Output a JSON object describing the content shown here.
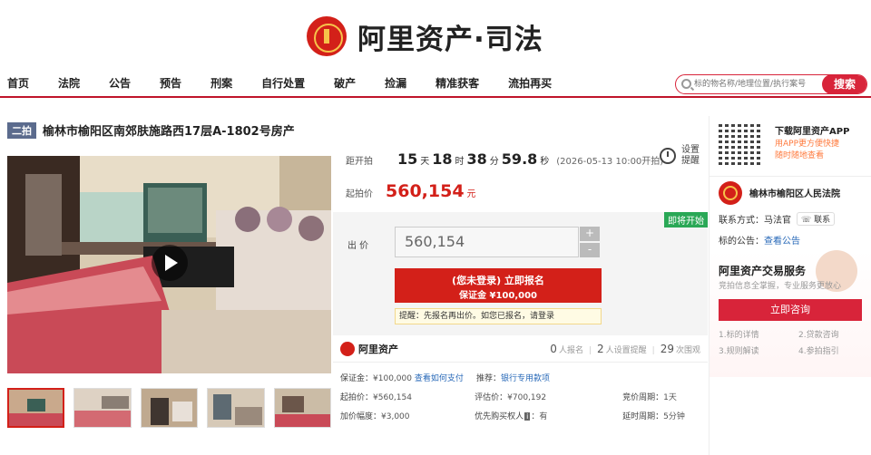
{
  "header": {
    "logo_text": "阿里资产·司法"
  },
  "nav": {
    "items": [
      "首页",
      "法院",
      "公告",
      "预告",
      "刑案",
      "自行处置",
      "破产",
      "捡漏",
      "精准获客",
      "流拍再买"
    ]
  },
  "search": {
    "placeholder": "标的物名称/地理位置/执行案号",
    "button": "搜索"
  },
  "item": {
    "round_tag": "二拍",
    "title": "榆林市榆阳区南郊肤施路西17层A-1802号房产"
  },
  "countdown": {
    "label": "距开拍",
    "days": "15",
    "days_unit": "天",
    "hours": "18",
    "hours_unit": "时",
    "minutes": "38",
    "minutes_unit": "分",
    "seconds": "59.8",
    "seconds_unit": "秒",
    "start_time": "(2026-05-13 10:00开拍)"
  },
  "remind": {
    "line1": "设置",
    "line2": "提醒"
  },
  "start_price": {
    "label": "起拍价",
    "value": "560,154",
    "unit": "元"
  },
  "bid": {
    "tag": "即将开始",
    "label": "出 价",
    "value": "560,154",
    "plus": "+",
    "minus": "-",
    "signup_line1": "(您未登录) 立即报名",
    "signup_line2": "保证金 ¥100,000",
    "tip": "提醒：先报名再出价。如您已报名，请登录"
  },
  "brand": {
    "name": "阿里资产"
  },
  "stats": [
    {
      "num": "0",
      "label": "人报名"
    },
    {
      "num": "2",
      "label": "人设置提醒"
    },
    {
      "num": "29",
      "label": "次围观"
    }
  ],
  "details": {
    "deposit_label": "保证金：",
    "deposit": "¥100,000",
    "pay_link": "查看如何支付",
    "recommend_label": "推荐：",
    "recommend_link": "银行专用款项",
    "start_label": "起拍价：",
    "start": "¥560,154",
    "assess_label": "评估价：",
    "assess": "¥700,192",
    "period_label": "竞价周期：",
    "period": "1天",
    "step_label": "加价幅度：",
    "step": "¥3,000",
    "priority_label": "优先购买权人",
    "priority_badge": "i",
    "priority": "：有",
    "delay_label": "延时周期：",
    "delay": "5分钟"
  },
  "sidebar": {
    "app_title": "下载阿里资产APP",
    "app_sub1": "用APP更方便快捷",
    "app_sub2": "随时随地查看",
    "court": "榆林市榆阳区人民法院",
    "contact_label": "联系方式：",
    "contact_name": "马法官",
    "contact_btn": "联系",
    "notice_label": "标的公告：",
    "notice_link": "查看公告",
    "svc_title": "阿里资产交易服务",
    "svc_sub": "竞拍信息全掌握，专业服务更放心",
    "consult": "立即咨询",
    "faq": [
      "1.标的详情",
      "2.贷款咨询",
      "3.规则解读",
      "4.参拍指引"
    ]
  },
  "colors": {
    "brand_red": "#d32019",
    "accent_red": "#d8243a",
    "tag_green": "#2aa856"
  }
}
